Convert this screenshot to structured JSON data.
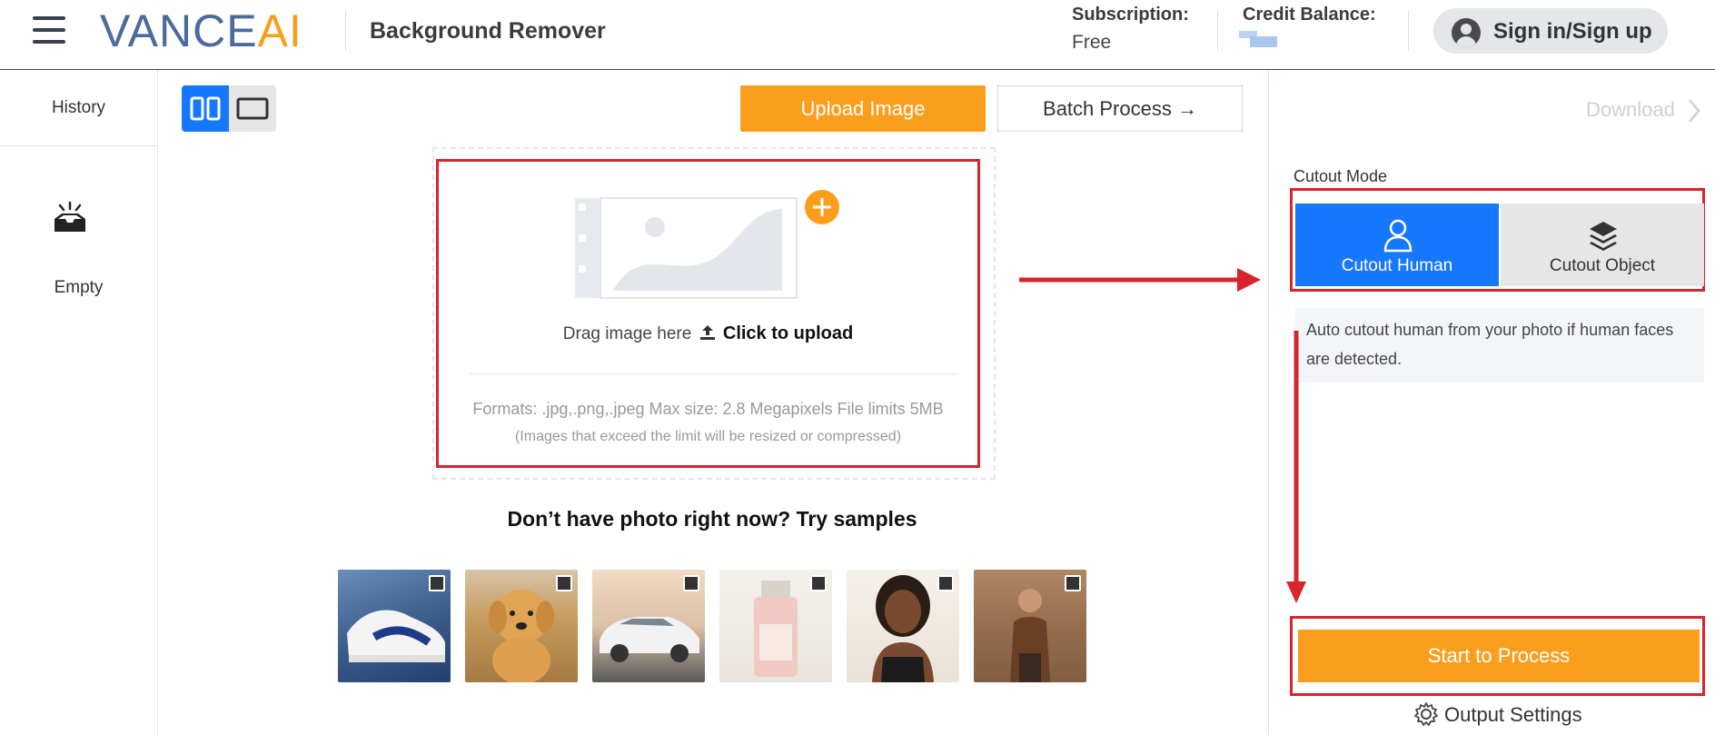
{
  "header": {
    "logo_vance": "VANCE",
    "logo_ai": "AI",
    "app_title": "Background Remover",
    "subscription_label": "Subscription:",
    "subscription_value": "Free",
    "credit_label": "Credit Balance:",
    "signin_label": "Sign in/Sign up"
  },
  "sidebar": {
    "history_label": "History",
    "empty_label": "Empty"
  },
  "toolbar": {
    "upload_label": "Upload Image",
    "batch_label": "Batch Process →"
  },
  "upload": {
    "drag_text": "Drag image here",
    "click_text": "Click to upload",
    "formats": "Formats: .jpg,.png,.jpeg Max size: 2.8 Megapixels File limits 5MB",
    "formats_note": "(Images that exceed the limit will be resized or compressed)"
  },
  "samples": {
    "title": "Don’t have photo right now? Try samples",
    "items": [
      "sneakers",
      "golden-retriever-puppy",
      "white-car",
      "skincare-bottle",
      "smiling-woman",
      "man-in-street"
    ]
  },
  "right_panel": {
    "download_label": "Download",
    "cutout_mode_label": "Cutout Mode",
    "mode_human_label": "Cutout Human",
    "mode_object_label": "Cutout Object",
    "mode_description": "Auto cutout human from your photo if human faces are detected.",
    "process_label": "Start to Process",
    "output_settings_label": "Output Settings"
  },
  "colors": {
    "accent_orange": "#fb9e1e",
    "accent_blue": "#1677ff",
    "annotation_red": "#d7242d",
    "logo_blue": "#4a6b9c"
  }
}
